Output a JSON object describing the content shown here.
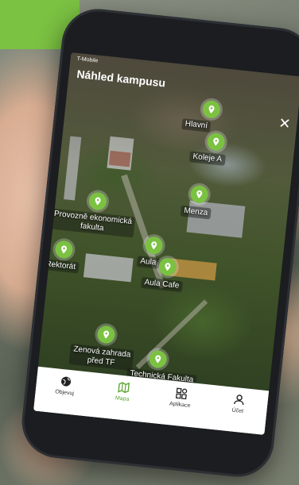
{
  "status": {
    "carrier": "T-Mobile"
  },
  "app": {
    "title": "Náhled kampusu",
    "close": "✕"
  },
  "pins": [
    {
      "name": "Hlavní",
      "label": "Hlavní"
    },
    {
      "name": "Koleje A",
      "label": "Koleje A"
    },
    {
      "name": "Menza",
      "label": "Menza"
    },
    {
      "name": "Provozně ekonomická fakulta",
      "label": "Provozně ekonomická\nfakulta",
      "line1": "Provozně ekonomická",
      "line2": "fakulta"
    },
    {
      "name": "Rektorát",
      "label": "Rektorát"
    },
    {
      "name": "Aula",
      "label": "Aula"
    },
    {
      "name": "Aula Cafe",
      "label": "Aula Cafe"
    },
    {
      "name": "Zenová zahrada před TF",
      "line1": "Zenová zahrada",
      "line2": "před TF"
    },
    {
      "name": "Technická Fakulta",
      "label": "Technická Fakulta"
    }
  ],
  "tabs": [
    {
      "label": "Objevuj",
      "icon": "globe-icon"
    },
    {
      "label": "Mapa",
      "icon": "map-icon"
    },
    {
      "label": "Aplikace",
      "icon": "apps-icon"
    },
    {
      "label": "Účet",
      "icon": "user-icon"
    }
  ],
  "colors": {
    "accent": "#7bc142",
    "active_tab": "#5fa632"
  }
}
